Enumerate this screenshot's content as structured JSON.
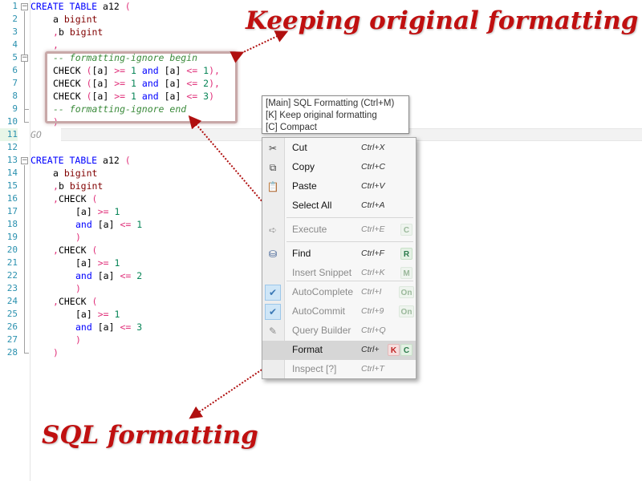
{
  "line_numbers": [
    "1",
    "2",
    "3",
    "4",
    "5",
    "6",
    "7",
    "8",
    "9",
    "10",
    "11",
    "12",
    "13",
    "14",
    "15",
    "16",
    "17",
    "18",
    "19",
    "20",
    "21",
    "22",
    "23",
    "24",
    "25",
    "26",
    "27",
    "28"
  ],
  "code": {
    "l1": {
      "kw1": "CREATE",
      "kw2": "TABLE",
      "name": "a12",
      "paren": "("
    },
    "l2": {
      "col": "a",
      "type": "bigint"
    },
    "l3": {
      "comma": ",",
      "col": "b",
      "type": "bigint"
    },
    "l4": {
      "comma": ","
    },
    "l5": {
      "comment": "-- formatting-ignore begin"
    },
    "l6": {
      "kw": "CHECK",
      "open": "(",
      "col1": "[a]",
      "op1": ">=",
      "n1": "1",
      "and": "and",
      "col2": "[a]",
      "op2": "<=",
      "n2": "1",
      "close": "),"
    },
    "l7": {
      "kw": "CHECK",
      "open": "(",
      "col1": "[a]",
      "op1": ">=",
      "n1": "1",
      "and": "and",
      "col2": "[a]",
      "op2": "<=",
      "n2": "2",
      "close": "),"
    },
    "l8": {
      "kw": "CHECK",
      "open": "(",
      "col1": "[a]",
      "op1": ">=",
      "n1": "1",
      "and": "and",
      "col2": "[a]",
      "op2": "<=",
      "n2": "3",
      "close": ")"
    },
    "l9": {
      "comment": "-- formatting-ignore end"
    },
    "l10": {
      "paren": ")"
    },
    "l11": {
      "go": "GO"
    },
    "l13": {
      "kw1": "CREATE",
      "kw2": "TABLE",
      "name": "a12",
      "paren": "("
    },
    "l14": {
      "col": "a",
      "type": "bigint"
    },
    "l15": {
      "comma": ",",
      "col": "b",
      "type": "bigint"
    },
    "l16": {
      "comma": ",",
      "kw": "CHECK",
      "open": "("
    },
    "l17": {
      "col": "[a]",
      "op": ">=",
      "n": "1"
    },
    "l18": {
      "and": "and",
      "col": "[a]",
      "op": "<=",
      "n": "1"
    },
    "l19": {
      "close": ")"
    },
    "l20": {
      "comma": ",",
      "kw": "CHECK",
      "open": "("
    },
    "l21": {
      "col": "[a]",
      "op": ">=",
      "n": "1"
    },
    "l22": {
      "and": "and",
      "col": "[a]",
      "op": "<=",
      "n": "2"
    },
    "l23": {
      "close": ")"
    },
    "l24": {
      "comma": ",",
      "kw": "CHECK",
      "open": "("
    },
    "l25": {
      "col": "[a]",
      "op": ">=",
      "n": "1"
    },
    "l26": {
      "and": "and",
      "col": "[a]",
      "op": "<=",
      "n": "3"
    },
    "l27": {
      "close": ")"
    },
    "l28": {
      "close": ")"
    }
  },
  "callouts": {
    "keep": "Keeping original formatting",
    "sql": "SQL formatting"
  },
  "tooltip": {
    "line1": "[Main] SQL Formatting (Ctrl+M)",
    "line2": "[K] Keep original formatting",
    "line3": "[C] Compact"
  },
  "menu": {
    "cut": {
      "label": "Cut",
      "shortcut": "Ctrl+X",
      "icon": "scissors-icon"
    },
    "copy": {
      "label": "Copy",
      "shortcut": "Ctrl+C",
      "icon": "copy-icon"
    },
    "paste": {
      "label": "Paste",
      "shortcut": "Ctrl+V",
      "icon": "paste-icon"
    },
    "select_all": {
      "label": "Select All",
      "shortcut": "Ctrl+A"
    },
    "execute": {
      "label": "Execute",
      "shortcut": "Ctrl+E",
      "badge": "C",
      "icon": "arrow-right-icon"
    },
    "find": {
      "label": "Find",
      "shortcut": "Ctrl+F",
      "badge": "R",
      "icon": "binoculars-icon"
    },
    "insert_snippet": {
      "label": "Insert Snippet",
      "shortcut": "Ctrl+K",
      "badge": "M"
    },
    "autocomplete": {
      "label": "AutoComplete",
      "shortcut": "Ctrl+I",
      "badge": "On",
      "icon": "checkmark-icon"
    },
    "autocommit": {
      "label": "AutoCommit",
      "shortcut": "Ctrl+9",
      "badge": "On",
      "icon": "checkmark-icon"
    },
    "query_builder": {
      "label": "Query Builder",
      "shortcut": "Ctrl+Q",
      "icon": "pencil-icon"
    },
    "format": {
      "label": "Format",
      "shortcut": "Ctrl+",
      "badge_k": "K",
      "badge_c": "C"
    },
    "inspect": {
      "label": "Inspect [?]",
      "shortcut": "Ctrl+T"
    }
  },
  "colors": {
    "keyword": "#0000ff",
    "type": "#800000",
    "operator": "#e0307a",
    "number": "#098658",
    "comment": "#3a8a3a",
    "callout": "#c01010",
    "line_number": "#2b91af"
  }
}
